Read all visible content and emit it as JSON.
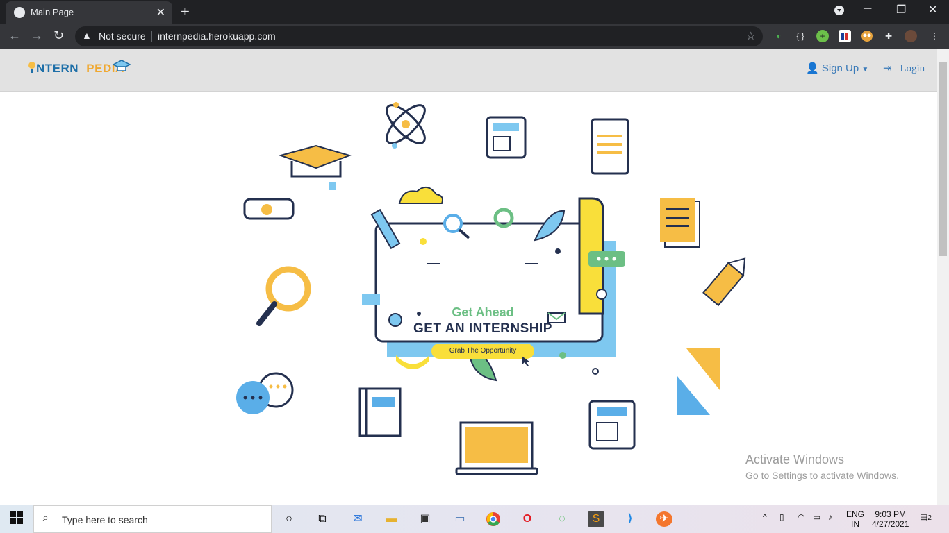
{
  "browser": {
    "tab_title": "Main Page",
    "tab_close": "✕",
    "new_tab": "+",
    "security_label": "Not secure",
    "url": "internpedia.herokuapp.com"
  },
  "site": {
    "logo_part1": "NTERN",
    "logo_part2": "PEDIA",
    "nav": {
      "signup_label": "Sign Up",
      "login_label": "Login"
    }
  },
  "hero": {
    "subheading": "Get Ahead",
    "heading": "GET AN INTERNSHIP",
    "cta_label": "Grab The Opportunity"
  },
  "watermark": {
    "line1": "Activate Windows",
    "line2": "Go to Settings to activate Windows."
  },
  "taskbar": {
    "search_placeholder": "Type here to search",
    "language_line1": "ENG",
    "language_line2": "IN",
    "time": "9:03 PM",
    "date": "4/27/2021",
    "notification_count": "2"
  },
  "colors": {
    "accent_yellow": "#f9df3a",
    "accent_blue": "#7ec8f0",
    "accent_green": "#6cbf84",
    "navy": "#24304f",
    "orange": "#f6bd45"
  }
}
